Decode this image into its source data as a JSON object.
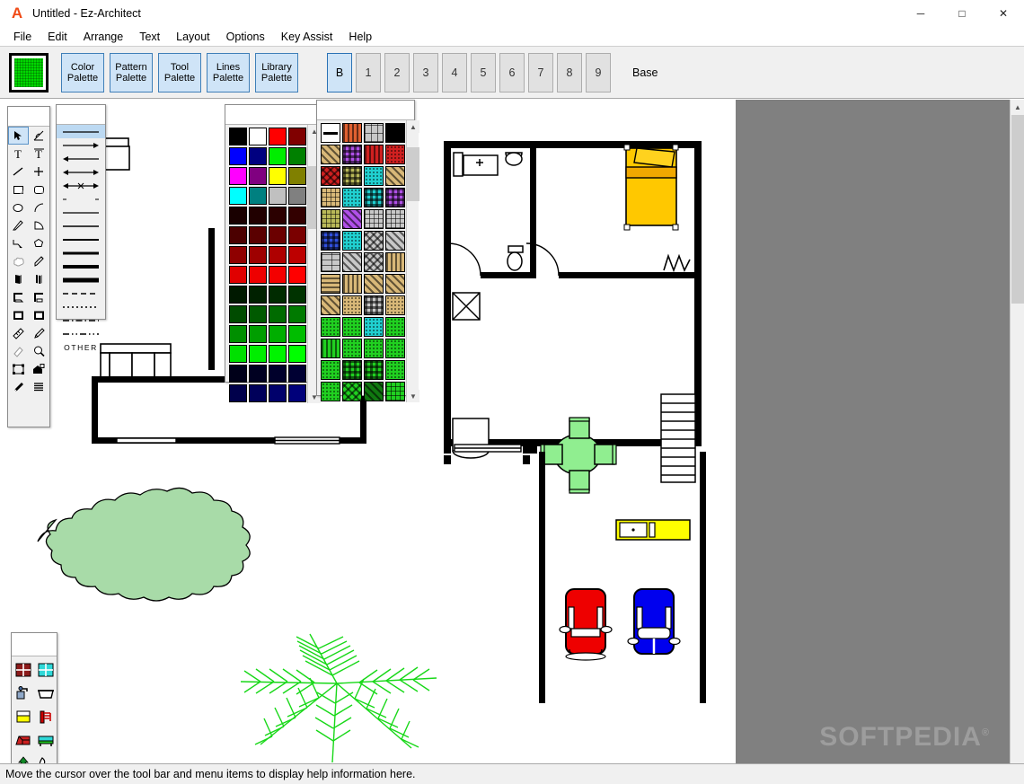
{
  "window": {
    "title": "Untitled - Ez-Architect",
    "app_icon": "A",
    "controls": [
      {
        "name": "minimize-button",
        "glyph": "─"
      },
      {
        "name": "maximize-button",
        "glyph": "□"
      },
      {
        "name": "close-button",
        "glyph": "✕"
      }
    ]
  },
  "menubar": {
    "items": [
      "File",
      "Edit",
      "Arrange",
      "Text",
      "Layout",
      "Options",
      "Key Assist",
      "Help"
    ]
  },
  "toolbar": {
    "fill_swatch_color": "#00d800",
    "palette_buttons": [
      {
        "line1": "Color",
        "line2": "Palette",
        "name": "color-palette-button"
      },
      {
        "line1": "Pattern",
        "line2": "Palette",
        "name": "pattern-palette-button"
      },
      {
        "line1": "Tool",
        "line2": "Palette",
        "name": "tool-palette-button"
      },
      {
        "line1": "Lines",
        "line2": "Palette",
        "name": "lines-palette-button"
      },
      {
        "line1": "Library",
        "line2": "Palette",
        "name": "library-palette-button"
      }
    ],
    "layer_buttons": [
      "B",
      "1",
      "2",
      "3",
      "4",
      "5",
      "6",
      "7",
      "8",
      "9"
    ],
    "active_layer": "B",
    "layer_name_label": "Base"
  },
  "tool_palette": {
    "active_index": 0,
    "tools": [
      "arrow-select-tool",
      "rotate-tool",
      "text-tool",
      "text-frame-tool",
      "line-tool",
      "crosshair-tool",
      "rectangle-tool",
      "rounded-rectangle-tool",
      "ellipse-tool",
      "arc-tool",
      "double-line-tool",
      "quarter-arc-tool",
      "polyline-tool",
      "polygon-tool",
      "freehand-tool",
      "pencil-tool",
      "wall-tool",
      "double-wall-tool",
      "corner-wall-tool",
      "corner-wall-2-tool",
      "frame-tool",
      "frame-2-tool",
      "ruler-tool",
      "paint-tool",
      "eraser-tool",
      "zoom-tool",
      "select-all-tool",
      "house-tool",
      "eyedropper-tool",
      "layers-tool"
    ]
  },
  "lines_palette": {
    "active_index": 0,
    "other_label": "OTHER",
    "styles": [
      "solid-thin",
      "arrow-right",
      "arrow-left",
      "arrow-both",
      "dimension-line",
      "dotted-sparse",
      "solid-1",
      "solid-2",
      "solid-3",
      "solid-4",
      "solid-5",
      "solid-6",
      "dashed",
      "dotted",
      "dash-dot",
      "dash-dot-dot"
    ]
  },
  "color_palette": {
    "rows": [
      [
        "#000000",
        "#ffffff",
        "#ff0000",
        "#800000"
      ],
      [
        "#0000ff",
        "#000080",
        "#00ee00",
        "#008000"
      ],
      [
        "#ff00ff",
        "#800080",
        "#ffff00",
        "#808000"
      ],
      [
        "#00ffff",
        "#008080",
        "#c0c0c0",
        "#808080"
      ],
      [
        "#190000",
        "#210000",
        "#2b0000",
        "#330000"
      ],
      [
        "#4b0000",
        "#5a0000",
        "#6b0000",
        "#7a0000"
      ],
      [
        "#8f0000",
        "#9e0000",
        "#ae0000",
        "#bd0000"
      ],
      [
        "#e00000",
        "#ee0000",
        "#f40000",
        "#ff0000"
      ],
      [
        "#001900",
        "#002100",
        "#002b00",
        "#003300"
      ],
      [
        "#004b00",
        "#005a00",
        "#006b00",
        "#007a00"
      ],
      [
        "#008f00",
        "#009e00",
        "#00ae00",
        "#00bd00"
      ],
      [
        "#00e000",
        "#00ee00",
        "#00f400",
        "#00ff00"
      ],
      [
        "#000019",
        "#000021",
        "#00002b",
        "#000033"
      ],
      [
        "#00004b",
        "#00005a",
        "#00006b",
        "#00007a"
      ]
    ]
  },
  "pattern_palette": {
    "patterns": [
      "solid-white-line",
      "orange-vertical-stripes",
      "gray-panel",
      "solid-black",
      "tan-diagonal",
      "purple-check",
      "red-pinstripe",
      "dark-red-noise",
      "red-weave",
      "olive-check",
      "teal-dots",
      "tan-diagonal-weave",
      "tan-lattice",
      "cyan-floral",
      "cyan-check",
      "purple-check-2",
      "olive-lattice",
      "lavender-diamond",
      "gray-lattice",
      "gray-grid",
      "blue-check",
      "cyan-circles",
      "gray-weave",
      "gray-herringbone",
      "gray-brick",
      "gray-diagonal",
      "gray-crosshatch",
      "tan-vertical",
      "tan-horizontal",
      "tan-pinstripe",
      "tan-diagonal-2",
      "tan-diagonal-3",
      "tan-diagonal-4",
      "tan-speckle",
      "black-check",
      "tan-dots",
      "green-noise",
      "green-mottle",
      "cyan-speckle",
      "green-speckle",
      "green-vertical",
      "green-dots",
      "green-dots-2",
      "green-dots-3",
      "green-dots-4",
      "green-check",
      "green-check-2",
      "green-dense",
      "green-dots-5",
      "green-weave",
      "green-dark",
      "green-grid"
    ]
  },
  "library_palette": {
    "items": [
      "window-red-icon",
      "window-cyan-icon",
      "faucet-icon",
      "bathtub-icon",
      "cabinet-icon",
      "chair-red-icon",
      "sofa-red-icon",
      "sofa-green-icon",
      "tree-icon",
      "sink-icon"
    ]
  },
  "statusbar": {
    "message": "Move the cursor over the tool bar and menu items to display help information here."
  },
  "canvas": {
    "watermark": "SOFTPEDIA",
    "watermark_mark": "®",
    "colors": {
      "bed": "#ffc800",
      "pillow": "#ffd21e",
      "counter": "#ffff00",
      "chair_green": "#90ee90",
      "table_green": "#90ee90",
      "car_red": "#ee0000",
      "car_blue": "#0000ee",
      "shrub_green": "#a8dba8",
      "fern_green": "#18d818",
      "wall": "#000000"
    }
  }
}
